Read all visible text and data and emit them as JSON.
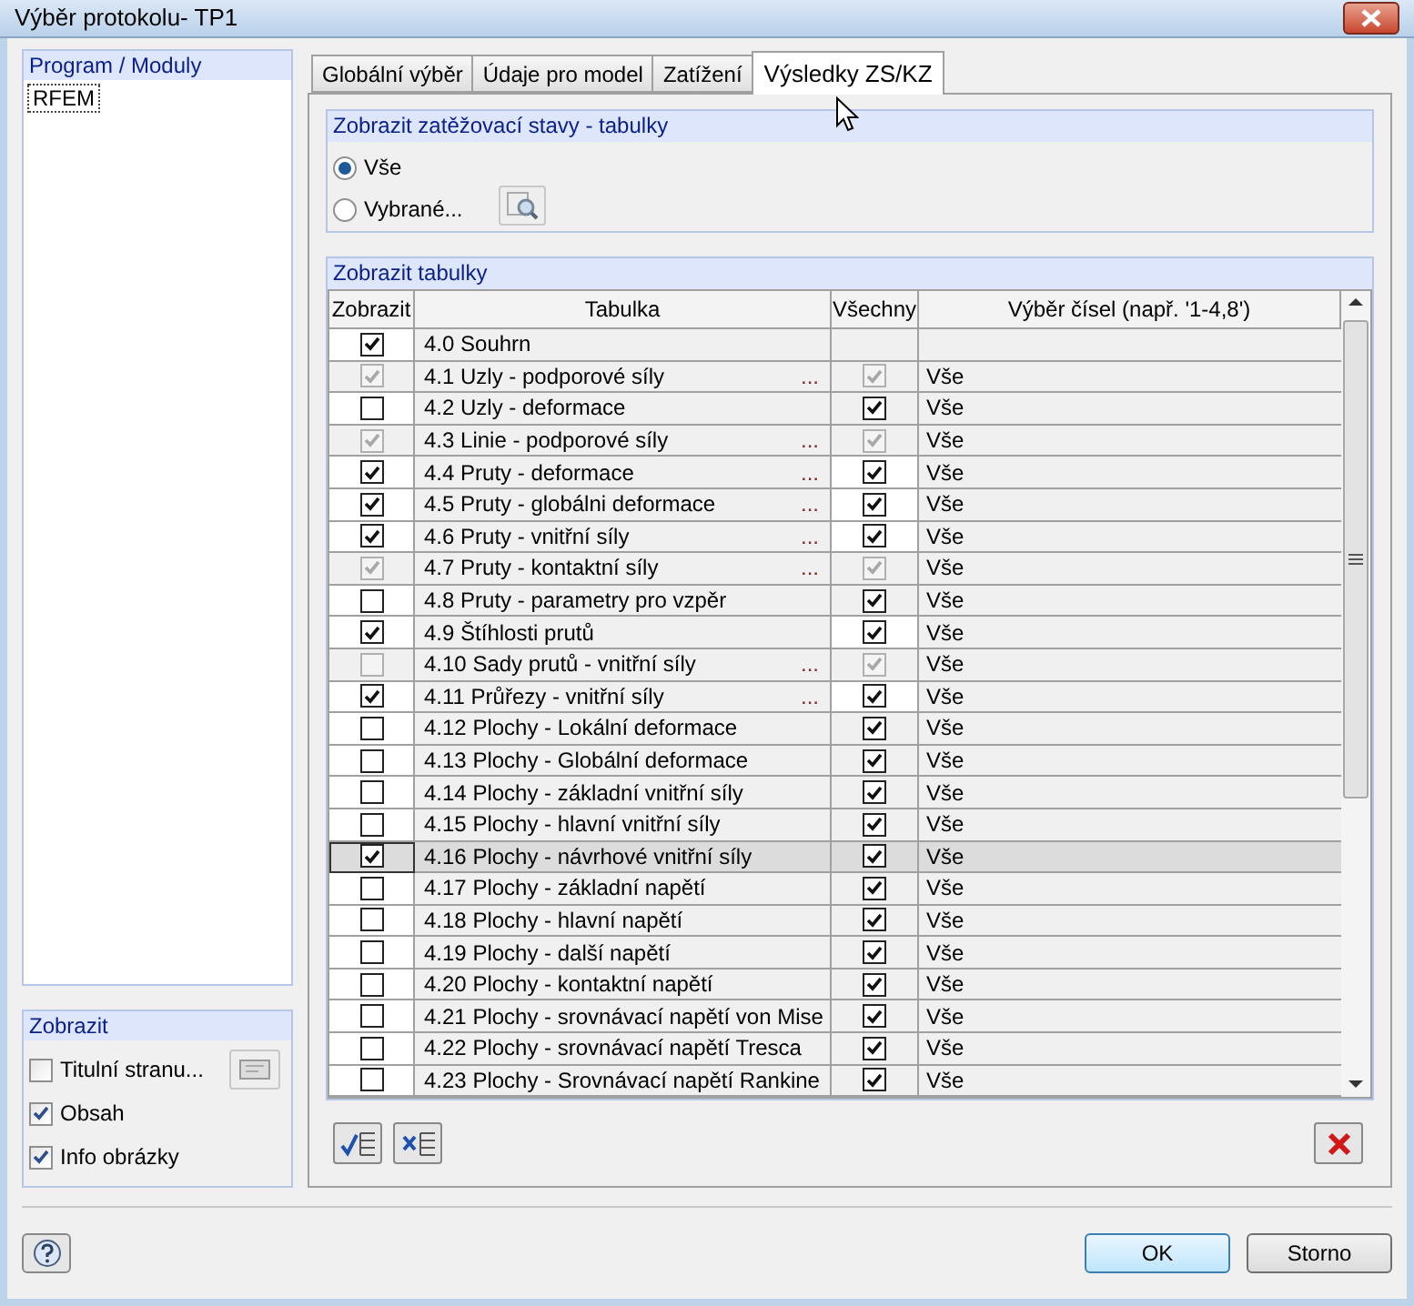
{
  "window": {
    "title": "Výběr protokolu- TP1"
  },
  "program_panel": {
    "title": "Program / Moduly",
    "items": [
      {
        "label": "RFEM"
      }
    ]
  },
  "display_panel": {
    "title": "Zobrazit",
    "options": [
      {
        "label": "Titulní stranu...",
        "checked": false
      },
      {
        "label": "Obsah",
        "checked": true
      },
      {
        "label": "Info obrázky",
        "checked": true
      }
    ]
  },
  "tabs": [
    {
      "label": "Globální výběr",
      "selected": false
    },
    {
      "label": "Údaje pro model",
      "selected": false
    },
    {
      "label": "Zatížení",
      "selected": false
    },
    {
      "label": "Výsledky ZS/KZ",
      "selected": true
    }
  ],
  "load_cases": {
    "title": "Zobrazit zatěžovací stavy - tabulky",
    "options": [
      {
        "label": "Vše",
        "selected": true
      },
      {
        "label": "Vybrané...",
        "selected": false
      }
    ]
  },
  "tables": {
    "title": "Zobrazit tabulky",
    "columns": [
      "Zobrazit",
      "Tabulka",
      "Všechny",
      "Výběr čísel (např. '1-4,8')"
    ],
    "rows": [
      {
        "show": true,
        "show_disabled": false,
        "label": "4.0 Souhrn",
        "selected": false
      },
      {
        "show": true,
        "show_disabled": true,
        "label": "4.1 Uzly - podporové síly",
        "more": "...",
        "all": true,
        "all_disabled": true,
        "numbers": "Vše",
        "selected": false
      },
      {
        "show": false,
        "show_disabled": false,
        "label": "4.2 Uzly - deformace",
        "all": true,
        "all_disabled": false,
        "numbers": "Vše",
        "selected": false
      },
      {
        "show": true,
        "show_disabled": true,
        "label": "4.3 Linie - podporové síly",
        "more": "...",
        "all": true,
        "all_disabled": true,
        "numbers": "Vše",
        "selected": false
      },
      {
        "show": true,
        "show_disabled": false,
        "label": "4.4 Pruty - deformace",
        "more": "...",
        "all": true,
        "all_disabled": false,
        "numbers": "Vše",
        "selected": false
      },
      {
        "show": true,
        "show_disabled": false,
        "label": "4.5 Pruty - globálni deformace",
        "more": "...",
        "all": true,
        "all_disabled": false,
        "numbers": "Vše",
        "selected": false
      },
      {
        "show": true,
        "show_disabled": false,
        "label": "4.6 Pruty - vnitřní síly",
        "more": "...",
        "all": true,
        "all_disabled": false,
        "numbers": "Vše",
        "selected": false
      },
      {
        "show": true,
        "show_disabled": true,
        "label": "4.7 Pruty - kontaktní síly",
        "more": "...",
        "all": true,
        "all_disabled": true,
        "numbers": "Vše",
        "selected": false
      },
      {
        "show": false,
        "show_disabled": false,
        "label": "4.8 Pruty - parametry pro vzpěr",
        "all": true,
        "all_disabled": false,
        "numbers": "Vše",
        "selected": false
      },
      {
        "show": true,
        "show_disabled": false,
        "label": "4.9 Štíhlosti prutů",
        "all": true,
        "all_disabled": false,
        "numbers": "Vše",
        "selected": false
      },
      {
        "show": false,
        "show_disabled": true,
        "label": "4.10 Sady prutů - vnitřní síly",
        "more": "...",
        "all": true,
        "all_disabled": true,
        "numbers": "Vše",
        "selected": false
      },
      {
        "show": true,
        "show_disabled": false,
        "label": "4.11 Průřezy - vnitřní síly",
        "more": "...",
        "all": true,
        "all_disabled": false,
        "numbers": "Vše",
        "selected": false
      },
      {
        "show": false,
        "show_disabled": false,
        "label": "4.12 Plochy - Lokální deformace",
        "all": true,
        "all_disabled": false,
        "numbers": "Vše",
        "selected": false
      },
      {
        "show": false,
        "show_disabled": false,
        "label": "4.13 Plochy - Globální deformace",
        "all": true,
        "all_disabled": false,
        "numbers": "Vše",
        "selected": false
      },
      {
        "show": false,
        "show_disabled": false,
        "label": "4.14 Plochy - základní vnitřní síly",
        "all": true,
        "all_disabled": false,
        "numbers": "Vše",
        "selected": false
      },
      {
        "show": false,
        "show_disabled": false,
        "label": "4.15 Plochy - hlavní vnitřní síly",
        "all": true,
        "all_disabled": false,
        "numbers": "Vše",
        "selected": false
      },
      {
        "show": true,
        "show_disabled": false,
        "label": "4.16 Plochy - návrhové vnitřní síly",
        "all": true,
        "all_disabled": false,
        "numbers": "Vše",
        "selected": true
      },
      {
        "show": false,
        "show_disabled": false,
        "label": "4.17 Plochy - základní napětí",
        "all": true,
        "all_disabled": false,
        "numbers": "Vše",
        "selected": false
      },
      {
        "show": false,
        "show_disabled": false,
        "label": "4.18 Plochy - hlavní napětí",
        "all": true,
        "all_disabled": false,
        "numbers": "Vše",
        "selected": false
      },
      {
        "show": false,
        "show_disabled": false,
        "label": "4.19 Plochy - další napětí",
        "all": true,
        "all_disabled": false,
        "numbers": "Vše",
        "selected": false
      },
      {
        "show": false,
        "show_disabled": false,
        "label": "4.20 Plochy - kontaktní napětí",
        "all": true,
        "all_disabled": false,
        "numbers": "Vše",
        "selected": false
      },
      {
        "show": false,
        "show_disabled": false,
        "label": "4.21 Plochy - srovnávací napětí von Mise",
        "all": true,
        "all_disabled": false,
        "numbers": "Vše",
        "selected": false
      },
      {
        "show": false,
        "show_disabled": false,
        "label": "4.22 Plochy - srovnávací napětí Tresca",
        "all": true,
        "all_disabled": false,
        "numbers": "Vše",
        "selected": false
      },
      {
        "show": false,
        "show_disabled": false,
        "label": "4.23 Plochy - Srovnávací napětí Rankine",
        "all": true,
        "all_disabled": false,
        "numbers": "Vše",
        "selected": false
      }
    ]
  },
  "buttons": {
    "ok": "OK",
    "cancel": "Storno"
  }
}
